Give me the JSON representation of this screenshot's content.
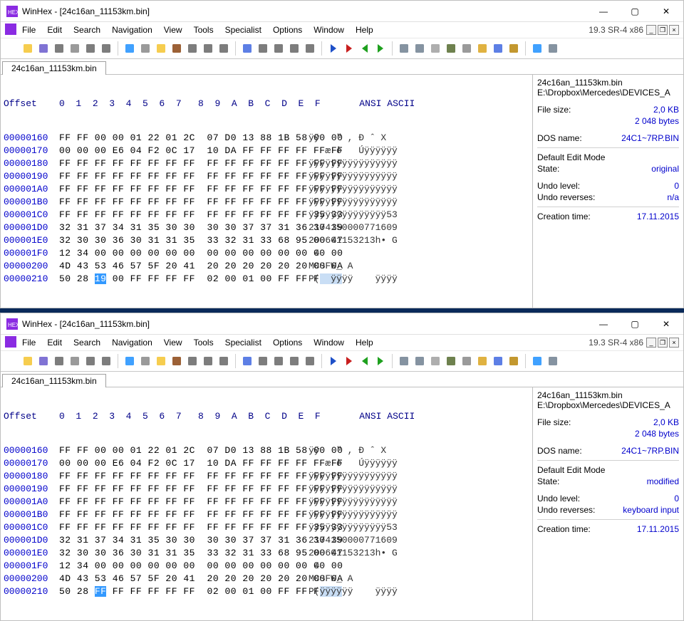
{
  "windows": [
    {
      "title": "WinHex - [24c16an_11153km.bin]",
      "version": "19.3 SR-4 x86",
      "menus": [
        "File",
        "Edit",
        "Search",
        "Navigation",
        "View",
        "Tools",
        "Specialist",
        "Options",
        "Window",
        "Help"
      ],
      "tab": "24c16an_11153km.bin",
      "header": "Offset    0  1  2  3  4  5  6  7   8  9  A  B  C  D  E  F       ANSI ASCII",
      "rows": [
        {
          "ofs": "00000160",
          "hex": "FF FF 00 00 01 22 01 2C  07 D0 13 88 1B 58 00 00",
          "asc": "ÿÿ   \" , Ð ˆ X"
        },
        {
          "ofs": "00000170",
          "hex": "00 00 00 E6 04 F2 0C 17  10 DA FF FF FF FF FF FF",
          "asc": "   æ ò   Úÿÿÿÿÿÿ"
        },
        {
          "ofs": "00000180",
          "hex": "FF FF FF FF FF FF FF FF  FF FF FF FF FF FF FF FF",
          "asc": "ÿÿÿÿÿÿÿÿÿÿÿÿÿÿÿÿ"
        },
        {
          "ofs": "00000190",
          "hex": "FF FF FF FF FF FF FF FF  FF FF FF FF FF FF FF FF",
          "asc": "ÿÿÿÿÿÿÿÿÿÿÿÿÿÿÿÿ"
        },
        {
          "ofs": "000001A0",
          "hex": "FF FF FF FF FF FF FF FF  FF FF FF FF FF FF FF FF",
          "asc": "ÿÿÿÿÿÿÿÿÿÿÿÿÿÿÿÿ"
        },
        {
          "ofs": "000001B0",
          "hex": "FF FF FF FF FF FF FF FF  FF FF FF FF FF FF FF FF",
          "asc": "ÿÿÿÿÿÿÿÿÿÿÿÿÿÿÿÿ"
        },
        {
          "ofs": "000001C0",
          "hex": "FF FF FF FF FF FF FF FF  FF FF FF FF FF FF 35 33",
          "asc": "ÿÿÿÿÿÿÿÿÿÿÿÿÿÿ53"
        },
        {
          "ofs": "000001D0",
          "hex": "32 31 37 34 31 35 30 30  30 30 37 37 31 36 30 39",
          "asc": "2174150000771609"
        },
        {
          "ofs": "000001E0",
          "hex": "32 30 30 36 30 31 31 35  33 32 31 33 68 95 00 47",
          "asc": "200601153213h• G"
        },
        {
          "ofs": "000001F0",
          "hex": "12 34 00 00 00 00 00 00  00 00 00 00 00 00 00 00",
          "asc": " 4"
        },
        {
          "ofs": "00000200",
          "hex": "4D 43 53 46 57 5F 20 41  20 20 20 20 20 20 00 0A",
          "asc": "MCSFW_ A"
        },
        {
          "ofs": "00000210",
          "hex": "50 28 19 00 FF FF FF FF  02 00 01 00 FF FF FF FF",
          "asc": "P(  ÿÿÿÿ    ÿÿÿÿ",
          "selHex": "19",
          "selCol": 2,
          "selAsc": 2
        }
      ],
      "side": {
        "filename": "24c16an_11153km.bin",
        "filepath": "E:\\Dropbox\\Mercedes\\DEVICES_A",
        "filesize_label": "File size:",
        "filesize": "2,0 KB",
        "bytes": "2 048 bytes",
        "dosname_label": "DOS name:",
        "dosname": "24C1~7RP.BIN",
        "editmode_label": "Default Edit Mode",
        "state_label": "State:",
        "state": "original",
        "undolevel_label": "Undo level:",
        "undolevel": "0",
        "undorev_label": "Undo reverses:",
        "undorev": "n/a",
        "ctime_label": "Creation time:",
        "ctime": "17.11.2015"
      }
    },
    {
      "title": "WinHex - [24c16an_11153km.bin]",
      "version": "19.3 SR-4 x86",
      "menus": [
        "File",
        "Edit",
        "Search",
        "Navigation",
        "View",
        "Tools",
        "Specialist",
        "Options",
        "Window",
        "Help"
      ],
      "tab": "24c16an_11153km.bin",
      "header": "Offset    0  1  2  3  4  5  6  7   8  9  A  B  C  D  E  F       ANSI ASCII",
      "rows": [
        {
          "ofs": "00000160",
          "hex": "FF FF 00 00 01 22 01 2C  07 D0 13 88 1B 58 00 00",
          "asc": "ÿÿ   \" , Ð ˆ X"
        },
        {
          "ofs": "00000170",
          "hex": "00 00 00 E6 04 F2 0C 17  10 DA FF FF FF FF FF FF",
          "asc": "   æ ò   Úÿÿÿÿÿÿ"
        },
        {
          "ofs": "00000180",
          "hex": "FF FF FF FF FF FF FF FF  FF FF FF FF FF FF FF FF",
          "asc": "ÿÿÿÿÿÿÿÿÿÿÿÿÿÿÿÿ"
        },
        {
          "ofs": "00000190",
          "hex": "FF FF FF FF FF FF FF FF  FF FF FF FF FF FF FF FF",
          "asc": "ÿÿÿÿÿÿÿÿÿÿÿÿÿÿÿÿ"
        },
        {
          "ofs": "000001A0",
          "hex": "FF FF FF FF FF FF FF FF  FF FF FF FF FF FF FF FF",
          "asc": "ÿÿÿÿÿÿÿÿÿÿÿÿÿÿÿÿ"
        },
        {
          "ofs": "000001B0",
          "hex": "FF FF FF FF FF FF FF FF  FF FF FF FF FF FF FF FF",
          "asc": "ÿÿÿÿÿÿÿÿÿÿÿÿÿÿÿÿ"
        },
        {
          "ofs": "000001C0",
          "hex": "FF FF FF FF FF FF FF FF  FF FF FF FF FF FF 35 33",
          "asc": "ÿÿÿÿÿÿÿÿÿÿÿÿÿÿ53"
        },
        {
          "ofs": "000001D0",
          "hex": "32 31 37 34 31 35 30 30  30 30 37 37 31 36 30 39",
          "asc": "2174150000771609"
        },
        {
          "ofs": "000001E0",
          "hex": "32 30 30 36 30 31 31 35  33 32 31 33 68 95 00 47",
          "asc": "200601153213h• G"
        },
        {
          "ofs": "000001F0",
          "hex": "12 34 00 00 00 00 00 00  00 00 00 00 00 00 00 00",
          "asc": " 4"
        },
        {
          "ofs": "00000200",
          "hex": "4D 43 53 46 57 5F 20 41  20 20 20 20 20 20 00 0A",
          "asc": "MCSFW_ A"
        },
        {
          "ofs": "00000210",
          "hex": "50 28 FF FF FF FF FF FF  02 00 01 00 FF FF FF FF",
          "asc": "P(ÿÿÿÿÿÿ    ÿÿÿÿ",
          "selHex": "FF",
          "selCol": 2,
          "selAsc": 2,
          "modAsc": true
        }
      ],
      "side": {
        "filename": "24c16an_11153km.bin",
        "filepath": "E:\\Dropbox\\Mercedes\\DEVICES_A",
        "filesize_label": "File size:",
        "filesize": "2,0 KB",
        "bytes": "2 048 bytes",
        "dosname_label": "DOS name:",
        "dosname": "24C1~7RP.BIN",
        "editmode_label": "Default Edit Mode",
        "state_label": "State:",
        "state": "modified",
        "undolevel_label": "Undo level:",
        "undolevel": "0",
        "undorev_label": "Undo reverses:",
        "undorev": "keyboard input",
        "ctime_label": "Creation time:",
        "ctime": "17.11.2015"
      }
    }
  ],
  "toolbar_icons": [
    "new",
    "open",
    "save",
    "save-as",
    "print",
    "props",
    "copy-sector",
    "divider",
    "undo",
    "cut",
    "copy",
    "paste",
    "paste-into",
    "clipboard",
    "bits",
    "divider",
    "find",
    "find-hex",
    "find-text",
    "goto",
    "replace",
    "divider",
    "jump-back",
    "jump-fwd",
    "back",
    "fwd",
    "divider",
    "disk1",
    "disk2",
    "ram",
    "calc",
    "zoom",
    "options",
    "analyze",
    "gear",
    "divider",
    "grid",
    "settings"
  ]
}
